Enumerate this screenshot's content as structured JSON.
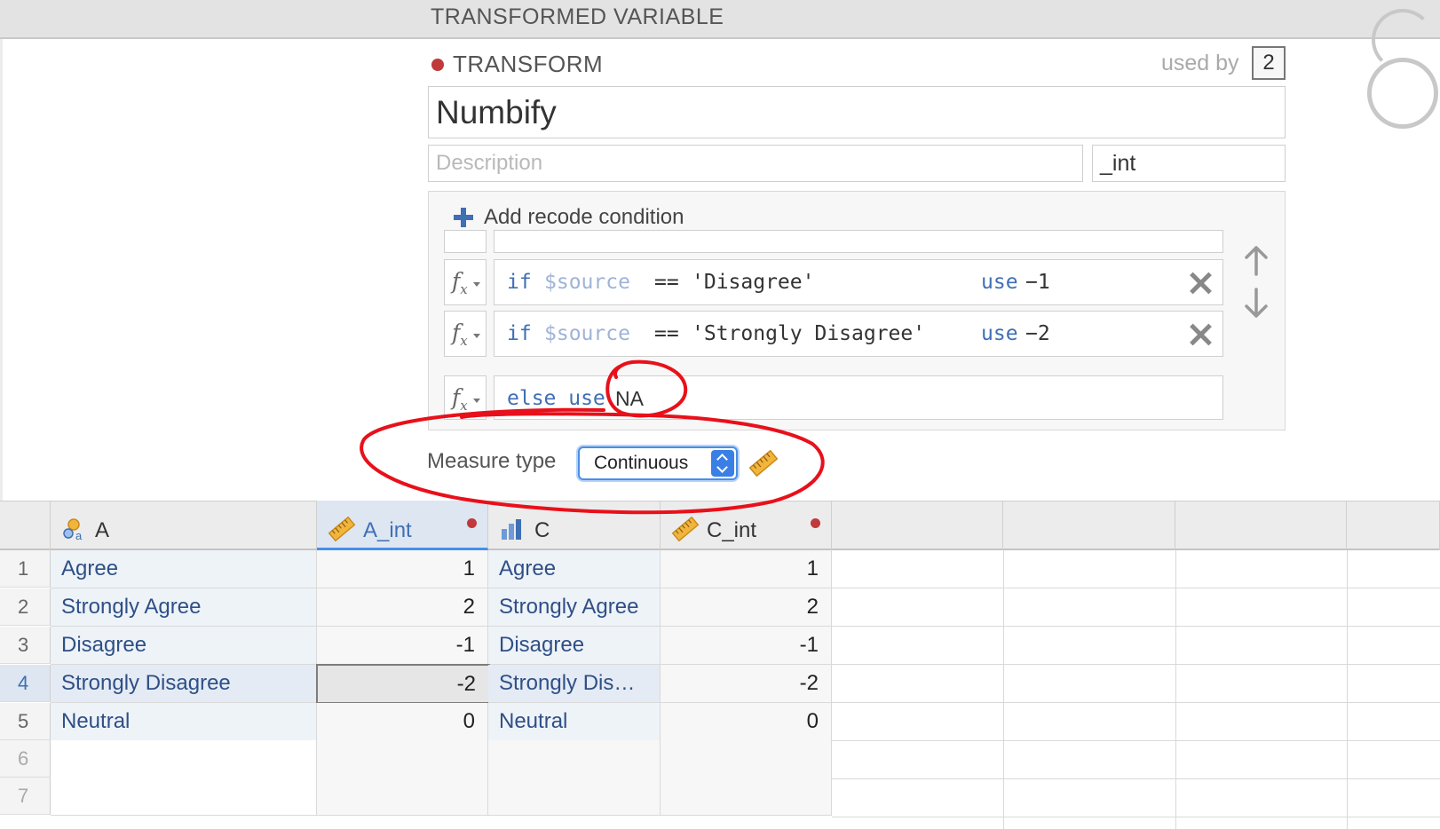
{
  "header": {
    "title": "TRANSFORMED VARIABLE"
  },
  "transform": {
    "section_label": "TRANSFORM",
    "used_by_label": "used by",
    "used_by_count": "2",
    "name": "Numbify",
    "description_placeholder": "Description",
    "suffix": "_int",
    "add_condition_label": "Add recode condition",
    "conditions": [
      {
        "if": "if",
        "var": "$source",
        "op": "==",
        "value": "'Disagree'",
        "use": "use",
        "result": "−1"
      },
      {
        "if": "if",
        "var": "$source",
        "op": "==",
        "value": "'Strongly Disagree'",
        "use": "use",
        "result": "−2"
      }
    ],
    "else_text": "else use",
    "else_value": "NA",
    "measure_type_label": "Measure type",
    "measure_type_value": "Continuous"
  },
  "colors": {
    "accent": "#4a8ee8",
    "keyword_blue": "#3f6fb5",
    "annotation_red": "#e8101a",
    "status_dot": "#c0393b"
  },
  "spreadsheet": {
    "columns": [
      {
        "name": "A",
        "icon": "nominal-text-icon",
        "modified": false
      },
      {
        "name": "A_int",
        "icon": "ruler-icon",
        "modified": true
      },
      {
        "name": "C",
        "icon": "bar-chart-icon",
        "modified": false
      },
      {
        "name": "C_int",
        "icon": "ruler-icon",
        "modified": true
      }
    ],
    "row_numbers": [
      "1",
      "2",
      "3",
      "4",
      "5",
      "6",
      "7"
    ],
    "rows": [
      [
        "Agree",
        "1",
        "Agree",
        "1"
      ],
      [
        "Strongly Agree",
        "2",
        "Strongly Agree",
        "2"
      ],
      [
        "Disagree",
        "-1",
        "Disagree",
        "-1"
      ],
      [
        "Strongly Disagree",
        "-2",
        "Strongly Dis…",
        "-2"
      ],
      [
        "Neutral",
        "0",
        "Neutral",
        "0"
      ]
    ],
    "selected_row": "4",
    "selected_column": "A_int"
  }
}
